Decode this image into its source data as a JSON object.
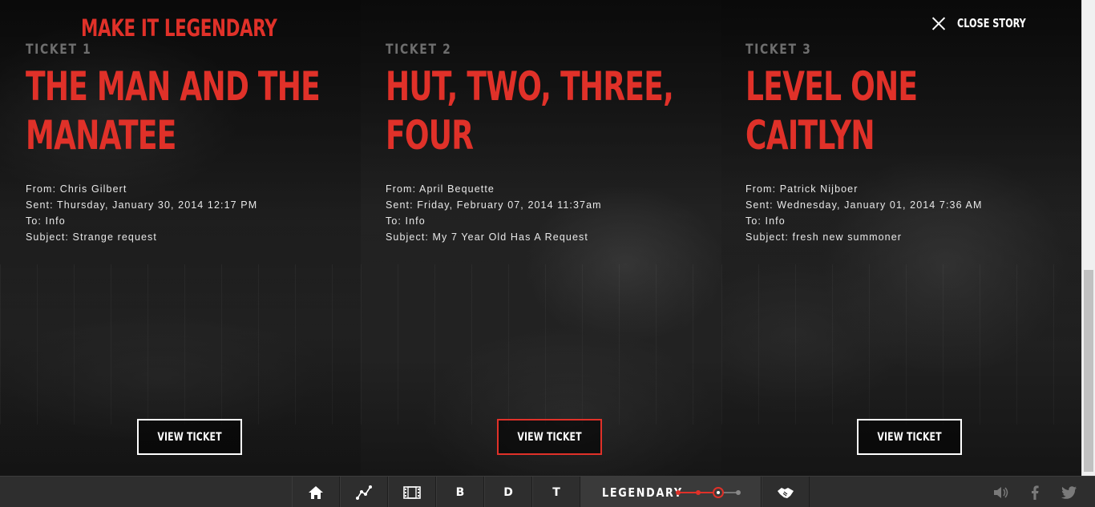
{
  "brand": {
    "title": "MAKE IT LEGENDARY"
  },
  "header": {
    "close_label": "CLOSE STORY",
    "close_icon": "close-icon"
  },
  "tickets": [
    {
      "number": "TICKET 1",
      "title": "THE MAN AND THE MANATEE",
      "from": "From: Chris Gilbert",
      "sent": "Sent: Thursday, January 30, 2014 12:17 PM",
      "to": "To: Info",
      "subject": "Subject: Strange request",
      "button": "VIEW TICKET"
    },
    {
      "number": "TICKET 2",
      "title": "HUT, TWO, THREE, FOUR",
      "from": "From: April Bequette",
      "sent": "Sent: Friday, February 07, 2014 11:37am",
      "to": "To: Info",
      "subject": "Subject: My 7 Year Old Has A Request",
      "button": "VIEW TICKET"
    },
    {
      "number": "TICKET 3",
      "title": "LEVEL ONE CAITLYN",
      "from": "From: Patrick Nijboer",
      "sent": "Sent: Wednesday, January 01, 2014 7:36 AM",
      "to": "To: Info",
      "subject": "Subject: fresh new summoner",
      "button": "VIEW TICKET"
    }
  ],
  "bottom_nav": {
    "items": [
      {
        "icon": "home-icon"
      },
      {
        "icon": "chart-line-icon"
      },
      {
        "icon": "film-icon"
      },
      {
        "label": "B"
      },
      {
        "label": "D"
      },
      {
        "label": "T"
      }
    ],
    "legendary_label": "LEGENDARY",
    "progress_steps": 4,
    "progress_current": 3,
    "handshake_icon": "handshake-icon"
  },
  "social": [
    "volume-icon",
    "facebook-icon",
    "twitter-icon"
  ],
  "colors": {
    "accent": "#e03129",
    "muted": "#6e6e6e",
    "bar": "#2e2e2e"
  }
}
